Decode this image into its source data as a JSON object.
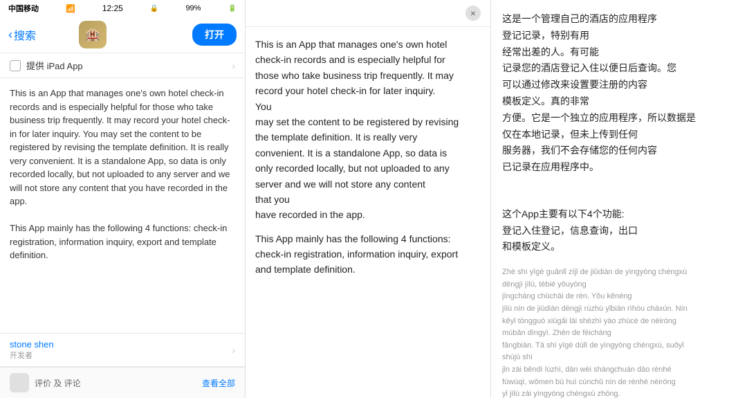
{
  "status_bar": {
    "carrier": "中国移动",
    "time": "12:25",
    "battery": "99%"
  },
  "nav": {
    "back_label": "搜索",
    "open_label": "打开"
  },
  "ipad_row": {
    "label": "提供 iPad App",
    "chevron": "›"
  },
  "app_description_short": "This is an App that manages one's own hotel check-in records and is especially helpful for those who take business trip frequently. It may record your hotel check-in for later inquiry. You may set the content to be registered by revising the template definition. It is really very convenient. It is a standalone App, so data is only recorded locally, but not uploaded to any server and we will not store any content that you have recorded in the app.\n\nThis App mainly has the following 4 functions: check-in registration, information inquiry, export and template definition.",
  "developer": {
    "name": "stone shen",
    "role": "开发者"
  },
  "review_bar": {
    "text": "评价 及 评论",
    "action": "查看全部"
  },
  "middle_panel": {
    "close_icon": "×",
    "paragraphs": [
      "This is an App that manages one's own hotel",
      "check-in records and is especially helpful for",
      "those who take business trip frequently. It may",
      "record your hotel check-in for later inquiry.",
      "You",
      "may set the content to be registered by revising",
      "the template definition. It is really very",
      "convenient. It is a standalone App, so data is",
      "only recorded locally, but not uploaded to any",
      "server and we will not store any content that you",
      "have recorded in the app.",
      "",
      "This App mainly has the following 4 functions:",
      "check-in registration, information inquiry, export",
      "and template definition."
    ]
  },
  "right_panel": {
    "chinese_text": "这是一个管理自己的酒店的应用程序\n登记记录，特别有用\n经常出差的人。有可能\n记录您的酒店登记入住以便日后查询。您\n可以通过修改来设置要注册的内容\n模板定义。真的非常\n方便。它是一个独立的应用程序，所以数据是\n仅在本地记录，但未上传到任何\n服务器，我们不会存储您的任何内容\n已记录在应用程序中。",
    "chinese_functions": "\n这个App主要有以下4个功能:\n登记入住登记，信息查询，出口\n和模板定义。",
    "pinyin": "Zhè shì yīgè guǎnlǐ zìjǐ de jiǔdiàn de yìngyòng chéngxù\ndēngjì jìlù, tèbié yǒuyòng\njīngcháng chūchāi de rén. Yǒu kěnéng\njìlù nín de jiǔdiàn dēngjì rùzhù yǐbiān rìhòu cháxún. Nín\nkěyǐ tōngguò xiūgǎi lái shèzhì yào zhùcè de nèiróng\nmúbǎn dìngyì. Zhēn de fēicháng\nfāngbiàn. Tā shì yīgè dúlì de yìngyòng chéngxù, suǒyǐ\nshùjù shì\njǐn zài běndì lùzhì, dàn wèi shàngchuán dào rènhé\nfúwùqì, wǒmen bù huì cúnchǔ nín de rènhé nèiróng\nyǐ jìlù zài yìngyòng chéngxù zhōng."
  }
}
